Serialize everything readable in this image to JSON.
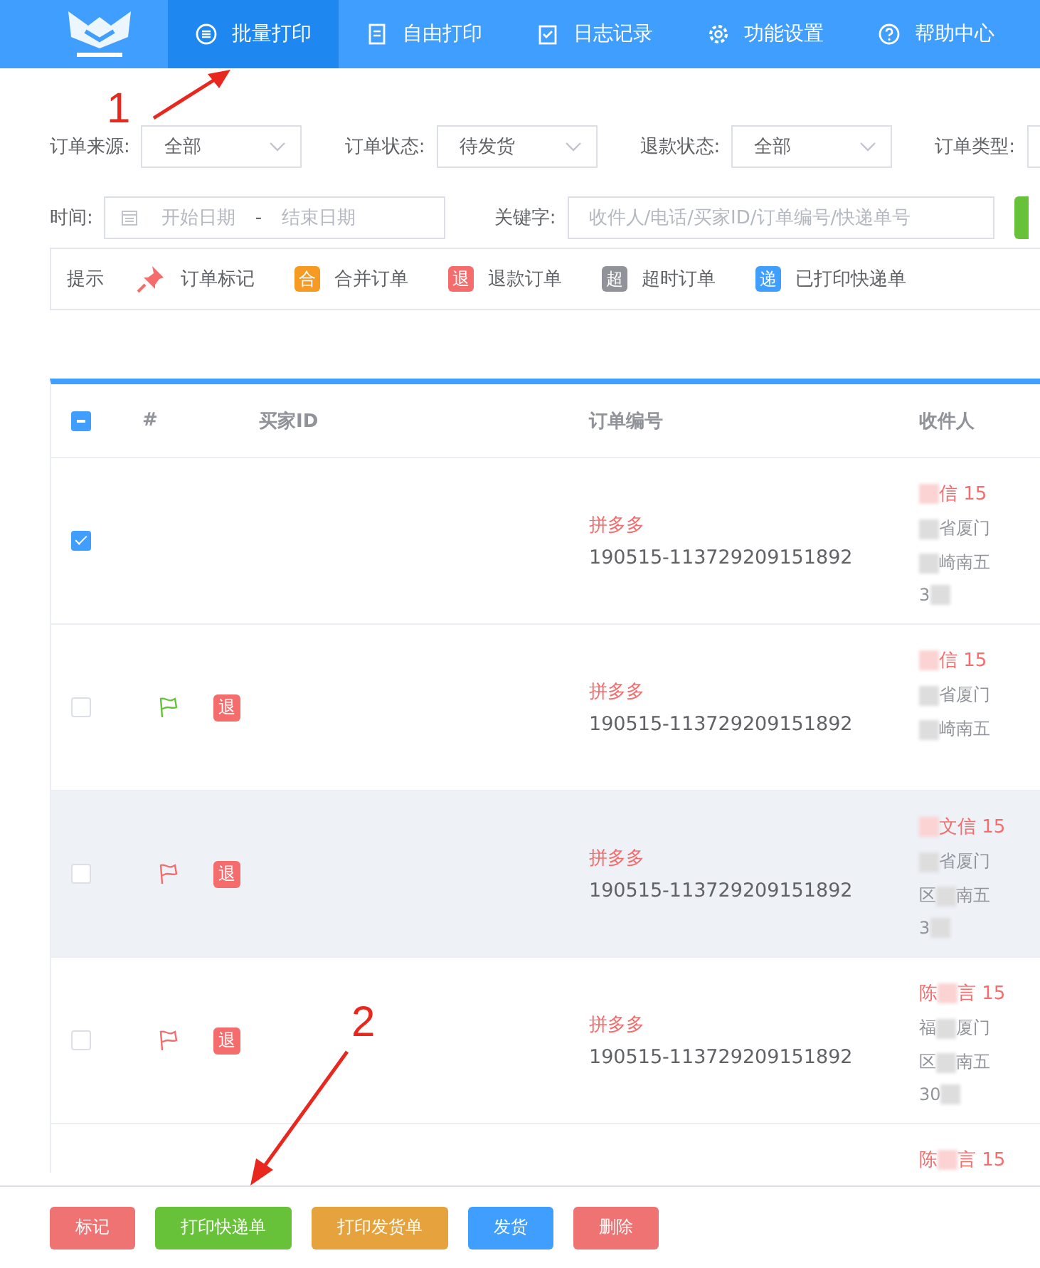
{
  "nav": {
    "tabs": [
      {
        "label": "批量打印",
        "selected": true
      },
      {
        "label": "自由打印",
        "selected": false
      },
      {
        "label": "日志记录",
        "selected": false
      },
      {
        "label": "功能设置",
        "selected": false
      },
      {
        "label": "帮助中心",
        "selected": false
      }
    ]
  },
  "filters": [
    {
      "label": "订单来源:",
      "value": "全部"
    },
    {
      "label": "订单状态:",
      "value": "待发货"
    },
    {
      "label": "退款状态:",
      "value": "全部"
    },
    {
      "label": "订单类型:"
    }
  ],
  "time": {
    "label": "时间:",
    "start_placeholder": "开始日期",
    "separator": "-",
    "end_placeholder": "结束日期"
  },
  "keyword": {
    "label": "关键字:",
    "placeholder": "收件人/电话/买家ID/订单编号/快递单号"
  },
  "legend": {
    "title": "提示",
    "items": [
      {
        "kind": "pin",
        "label": "订单标记"
      },
      {
        "kind": "badge",
        "badge": "合",
        "color": "#f59a23",
        "label": "合并订单"
      },
      {
        "kind": "badge",
        "badge": "退",
        "color": "#f56c6c",
        "label": "退款订单"
      },
      {
        "kind": "badge",
        "badge": "超",
        "color": "#909399",
        "label": "超时订单"
      },
      {
        "kind": "badge",
        "badge": "递",
        "color": "#409eff",
        "label": "已打印快递单"
      }
    ]
  },
  "table": {
    "header_checkbox": {
      "indeterminate": true
    },
    "columns": [
      "#",
      "买家ID",
      "订单编号",
      "收件人"
    ],
    "rows": [
      {
        "selected": true,
        "hovered": false,
        "source": "拼多多",
        "order_no": "190515-113729209151892",
        "recipient": [
          {
            "after": "信 15"
          },
          {
            "after": "省厦门"
          },
          {
            "after": "崎南五"
          },
          {
            "before": "3"
          }
        ]
      },
      {
        "selected": false,
        "hovered": false,
        "color": "#67c23a",
        "badge": "退",
        "source": "拼多多",
        "order_no": "190515-113729209151892",
        "recipient": [
          {
            "after": "信 15"
          },
          {
            "after": "省厦门"
          },
          {
            "after": "崎南五"
          }
        ]
      },
      {
        "selected": false,
        "hovered": true,
        "color": "#f56c6c",
        "badge": "退",
        "source": "拼多多",
        "order_no": "190515-113729209151892",
        "recipient": [
          {
            "after": "文信 15"
          },
          {
            "after": "省厦门"
          },
          {
            "before": "区",
            "after": "南五"
          },
          {
            "before": "3"
          }
        ]
      },
      {
        "selected": false,
        "hovered": false,
        "color": "#f56c6c",
        "badge": "退",
        "source": "拼多多",
        "order_no": "190515-113729209151892",
        "recipient": [
          {
            "before": "陈",
            "after": "言 15"
          },
          {
            "before": "福",
            "after": "厦门"
          },
          {
            "before": "区",
            "after": "南五"
          },
          {
            "before": "30"
          }
        ]
      },
      {
        "hovered": false,
        "recipient": [
          {
            "before": "陈",
            "after": "言 15"
          }
        ]
      }
    ]
  },
  "actions": [
    {
      "label": "标记",
      "color": "#f07373"
    },
    {
      "label": "打印快递单",
      "color": "#67c23a"
    },
    {
      "label": "打印发货单",
      "color": "#e6a23c"
    },
    {
      "label": "发货",
      "color": "#409eff"
    },
    {
      "label": "删除",
      "color": "#f07373"
    }
  ],
  "annotations": [
    "1",
    "2"
  ]
}
